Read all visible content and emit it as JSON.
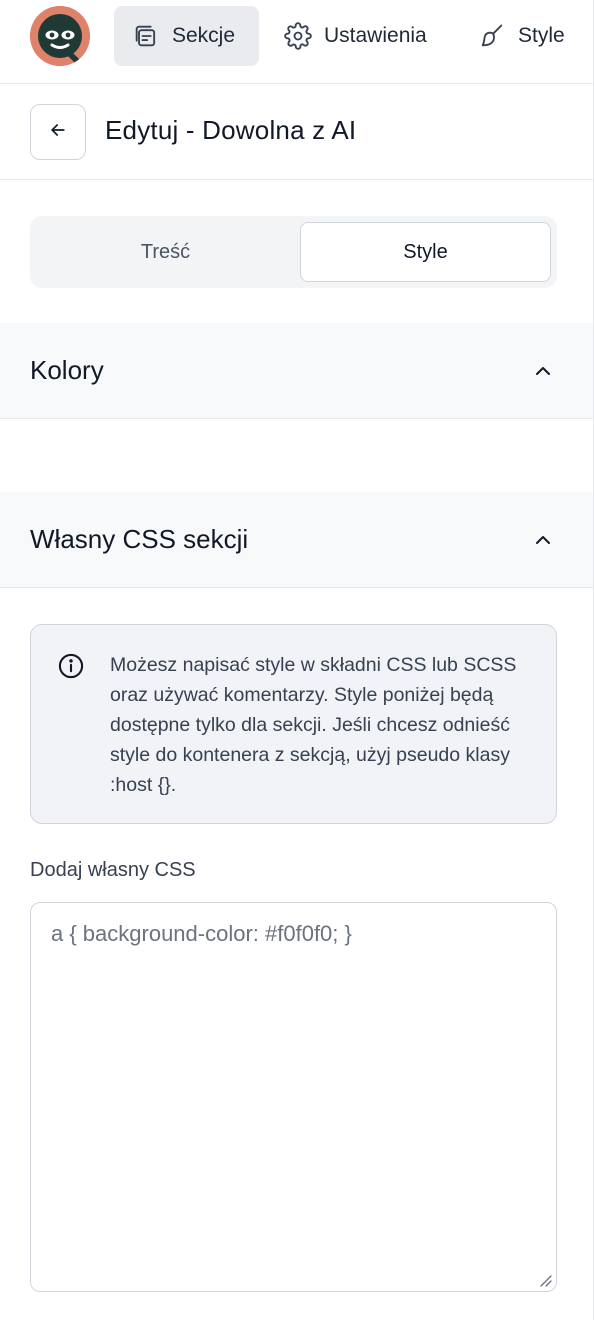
{
  "nav": {
    "items": [
      {
        "label": "Sekcje",
        "icon": "copy-icon",
        "active": true
      },
      {
        "label": "Ustawienia",
        "icon": "gear-icon",
        "active": false
      },
      {
        "label": "Style",
        "icon": "brush-icon",
        "active": false
      }
    ]
  },
  "header": {
    "title": "Edytuj - Dowolna z AI"
  },
  "tabs": [
    {
      "label": "Treść",
      "active": false
    },
    {
      "label": "Style",
      "active": true
    }
  ],
  "sections": {
    "colors": {
      "title": "Kolory",
      "expanded": true
    },
    "custom_css": {
      "title": "Własny CSS sekcji",
      "expanded": true
    }
  },
  "info": {
    "text": "Możesz napisać style w składni CSS lub SCSS oraz używać komentarzy. Style poniżej będą dostępne tylko dla sekcji. Jeśli chcesz odnieść style do kontenera z sekcją, użyj pseudo klasy :host {}."
  },
  "css_field": {
    "label": "Dodaj własny CSS",
    "value": "",
    "placeholder": "a { background-color: #f0f0f0; }"
  },
  "colors": {
    "logo_bg": "#e0826a",
    "logo_dark": "#1f3a35",
    "active_nav_bg": "#e9ebef",
    "section_bg": "#f8f9fb"
  }
}
